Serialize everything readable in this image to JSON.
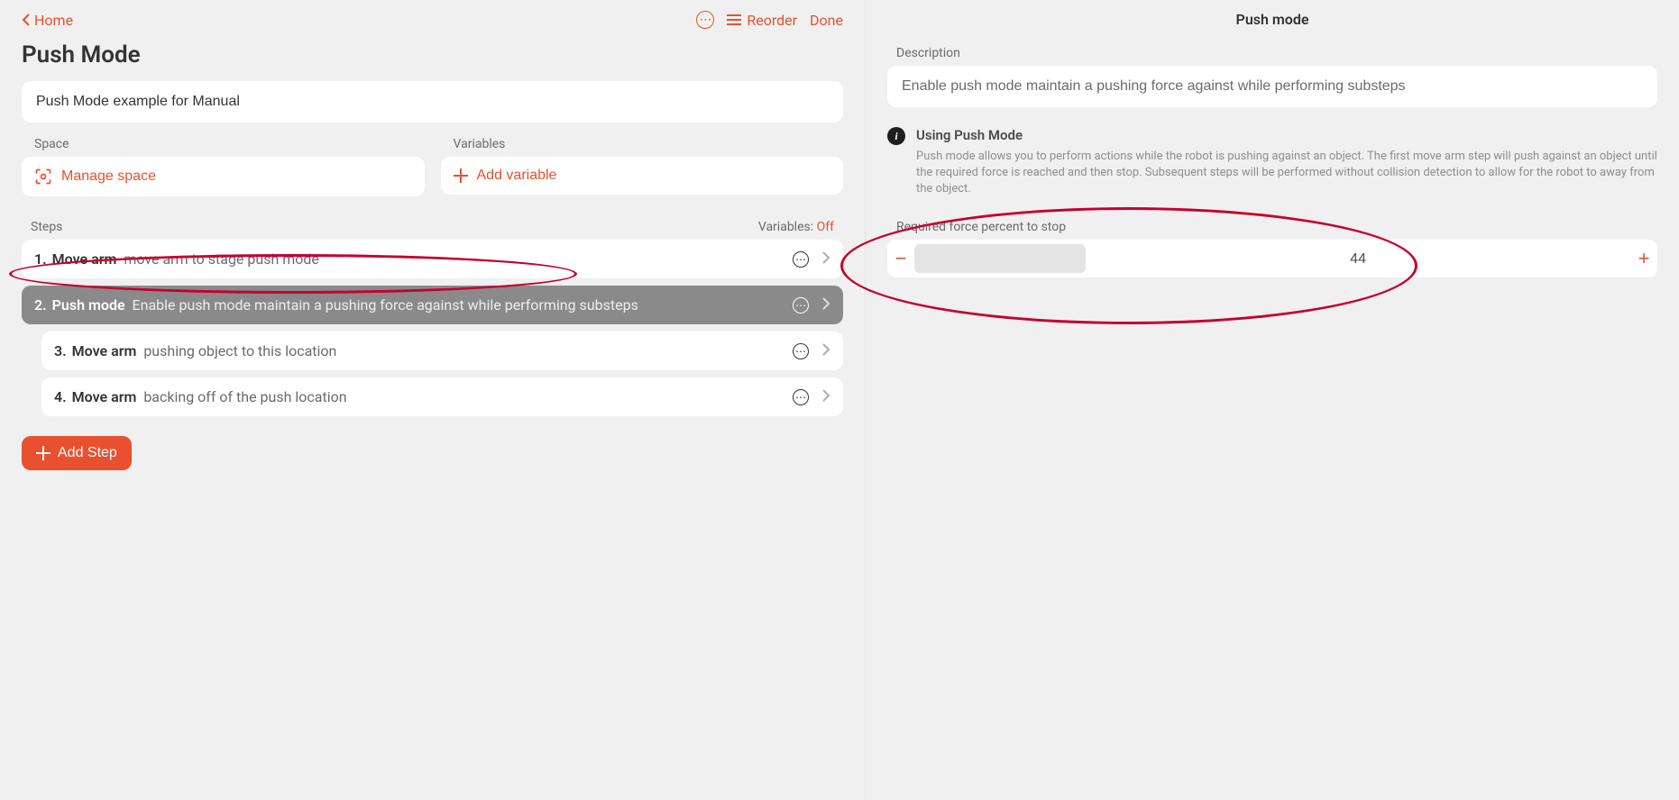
{
  "top": {
    "home": "Home",
    "reorder": "Reorder",
    "done": "Done"
  },
  "page_title": "Push Mode",
  "title_field_value": "Push Mode example for Manual",
  "space": {
    "label": "Space",
    "button": "Manage space"
  },
  "variables": {
    "label": "Variables",
    "button": "Add variable"
  },
  "steps_header": {
    "label": "Steps",
    "variables_prefix": "Variables:",
    "variables_value": "Off"
  },
  "steps": [
    {
      "n": "1.",
      "title": "Move arm",
      "desc": "move arm to stage push mode",
      "indent": false,
      "selected": false
    },
    {
      "n": "2.",
      "title": "Push mode",
      "desc": "Enable push mode maintain a pushing force against while performing substeps",
      "indent": false,
      "selected": true
    },
    {
      "n": "3.",
      "title": "Move arm",
      "desc": "pushing object to this location",
      "indent": true,
      "selected": false
    },
    {
      "n": "4.",
      "title": "Move arm",
      "desc": "backing off of the push location",
      "indent": true,
      "selected": false
    }
  ],
  "add_step": "Add Step",
  "right": {
    "title": "Push mode",
    "description_label": "Description",
    "description_value": "Enable push mode maintain a pushing force against while performing substeps",
    "info_title": "Using Push Mode",
    "info_body": "Push mode allows you to perform actions while the robot is pushing against an object. The first move arm step will push against an object until the required force is reached and then stop. Subsequent steps will be performed without collision detection to allow for the robot to away from the object.",
    "force_label": "Required force percent to stop",
    "force_value": "44"
  }
}
